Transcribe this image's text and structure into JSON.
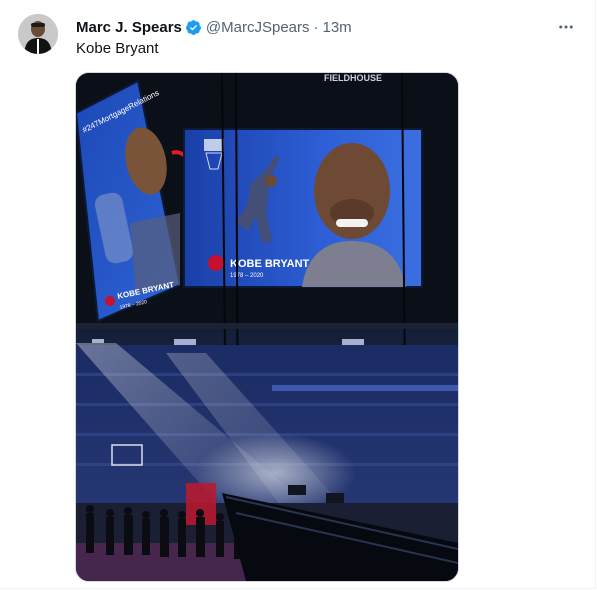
{
  "tweet": {
    "author_name": "Marc J. Spears",
    "handle": "@MarcJSpears",
    "separator": "·",
    "time": "13m",
    "text": "Kobe Bryant"
  },
  "media": {
    "board_left_top_text": "#247MortgageRelations",
    "board_left_name": "KOBE BRYANT",
    "board_left_years": "1978 – 2020",
    "board_main_name": "KOBE BRYANT",
    "board_main_years": "1978 – 2020",
    "venue_sign": "FIELDHOUSE"
  },
  "icons": {
    "verified": "verified-badge-icon",
    "more": "more-horizontal-icon"
  },
  "colors": {
    "verified_blue": "#1d9bf0",
    "secondary_text": "#536471"
  }
}
